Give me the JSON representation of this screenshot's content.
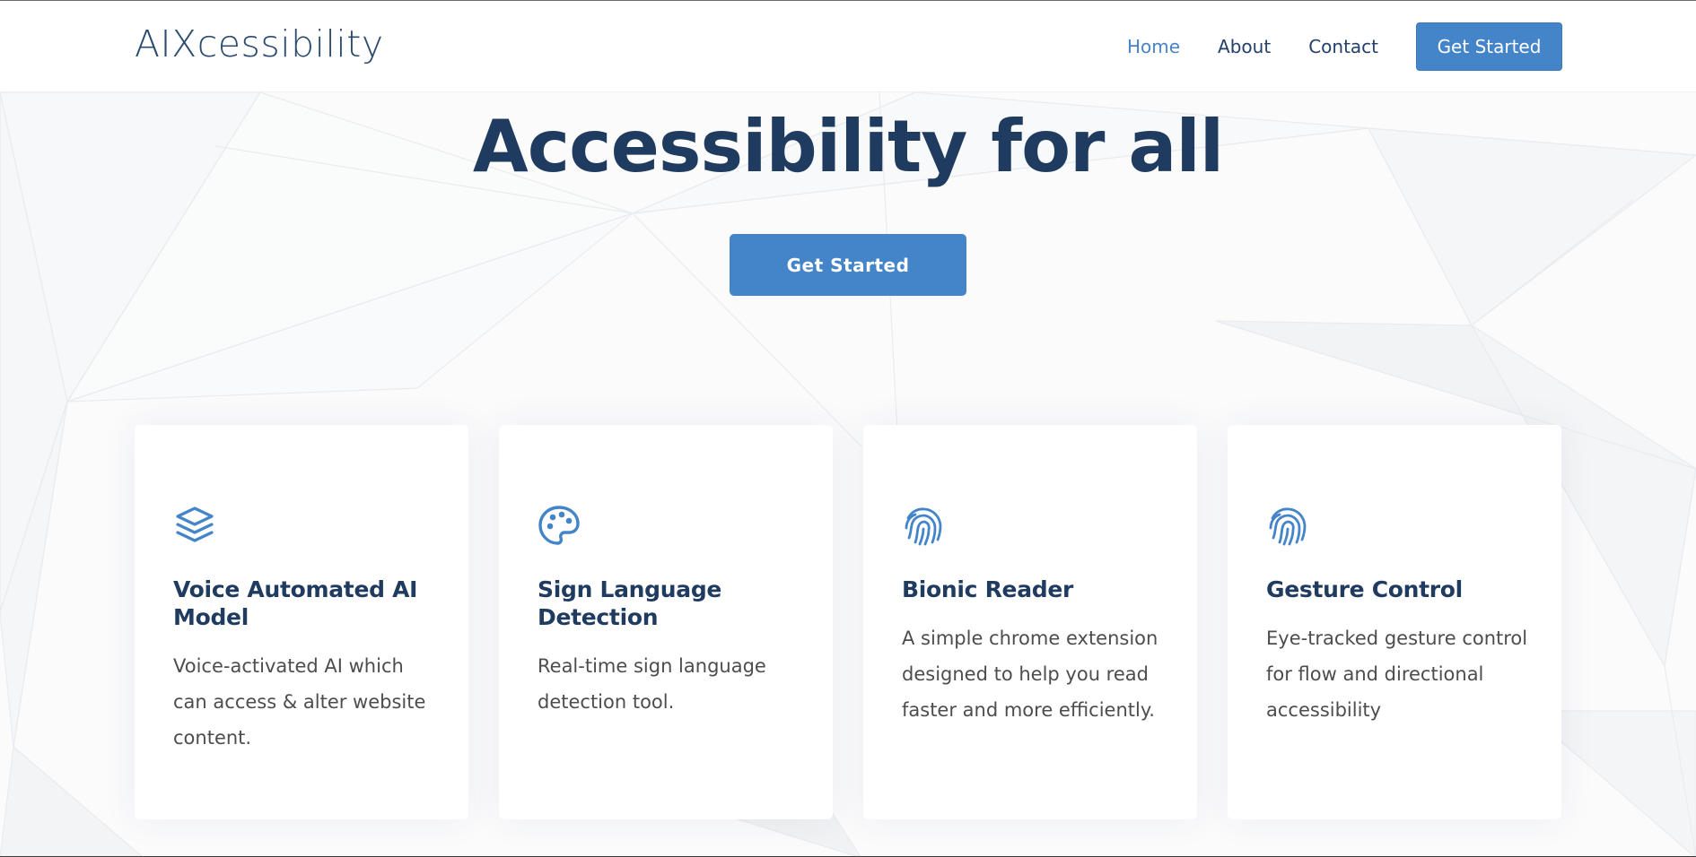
{
  "header": {
    "logo": "AIXcessibility",
    "nav": [
      {
        "label": "Home",
        "active": true
      },
      {
        "label": "About",
        "active": false
      },
      {
        "label": "Contact",
        "active": false
      }
    ],
    "cta_label": "Get Started"
  },
  "hero": {
    "title": "Accessibility for all",
    "cta_label": "Get Started"
  },
  "cards": [
    {
      "icon": "layers-icon",
      "title": "Voice Automated AI Model",
      "description": "Voice-activated AI which can access & alter website content."
    },
    {
      "icon": "palette-icon",
      "title": "Sign Language Detection",
      "description": "Real-time sign language detection tool."
    },
    {
      "icon": "fingerprint-icon",
      "title": "Bionic Reader",
      "description": "A simple chrome extension designed to help you read faster and more efficiently."
    },
    {
      "icon": "fingerprint-icon",
      "title": "Gesture Control",
      "description": "Eye-tracked gesture control for flow and directional accessibility"
    }
  ],
  "colors": {
    "accent": "#4484c8",
    "heading": "#1f3b5f",
    "body_text": "#4d4d4d",
    "active_nav": "#4a82c6"
  }
}
